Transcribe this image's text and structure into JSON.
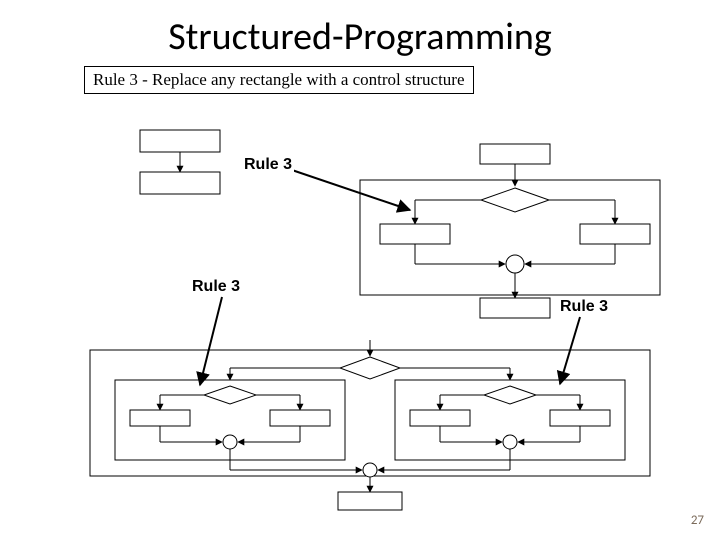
{
  "title": "Structured-Programming",
  "subtitle": "Rule 3 - Replace any rectangle with a control structure",
  "labels": {
    "rule3_a": "Rule 3",
    "rule3_b": "Rule 3",
    "rule3_c": "Rule 3"
  },
  "page_number": "27"
}
